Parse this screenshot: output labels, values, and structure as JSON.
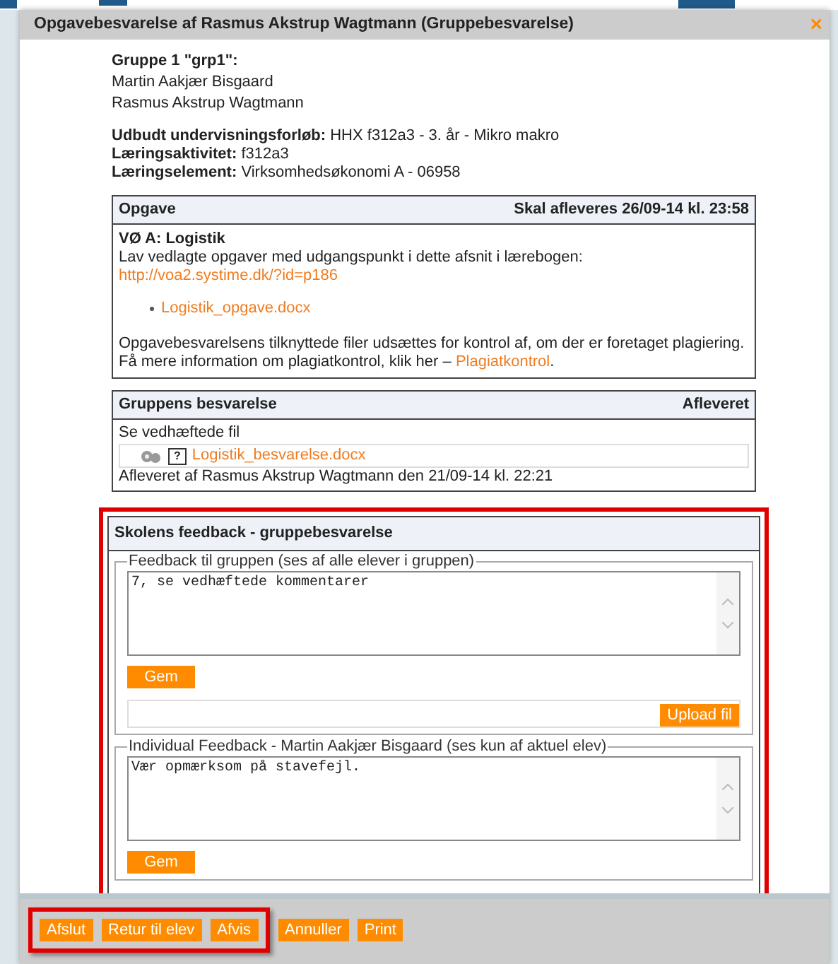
{
  "window": {
    "title": "Opgavebesvarelse af Rasmus Akstrup Wagtmann (Gruppebesvarelse)",
    "close": "×"
  },
  "group": {
    "heading": "Gruppe 1 \"grp1\":",
    "members": [
      "Martin Aakjær Bisgaard",
      "Rasmus Akstrup Wagtmann"
    ]
  },
  "info": [
    {
      "label": "Udbudt undervisningsforløb:",
      "value": "HHX f312a3 - 3. år - Mikro makro"
    },
    {
      "label": "Læringsaktivitet:",
      "value": "f312a3"
    },
    {
      "label": "Læringselement:",
      "value": "Virksomhedsøkonomi A - 06958"
    }
  ],
  "task": {
    "header_left": "Opgave",
    "header_right": "Skal afleveres 26/09-14 kl. 23:58",
    "title": "VØ A: Logistik",
    "text": "Lav vedlagte opgaver med udgangspunkt i dette afsnit i lærebogen:",
    "link_parts": [
      "http://voa2.systime.dk/?",
      "id=p186"
    ],
    "attachments": [
      "Logistik_opgave.docx"
    ],
    "plagiarism_text": "Opgavebesvarelsens tilknyttede filer udsættes for kontrol af, om der er foretaget plagiering. Få mere information om plagiatkontrol, klik her –",
    "plagiarism_link": "Plagiatkontrol",
    "plagiarism_end": "."
  },
  "submission": {
    "header_left": "Gruppens besvarelse",
    "header_right": "Afleveret",
    "text": "Se vedhæftede fil",
    "file_help": "?",
    "file": "Logistik_besvarelse.docx",
    "delivered": "Afleveret af Rasmus Akstrup Wagtmann den 21/09-14 kl. 22:21"
  },
  "feedback": {
    "heading": "Skolens feedback - gruppebesvarelse",
    "highlighted": true,
    "group": {
      "legend": "Feedback til gruppen (ses af alle elever i gruppen)",
      "value": "7, se vedhæftede kommentarer",
      "save": "Gem",
      "upload": "Upload fil"
    },
    "individual": {
      "legend": "Individual Feedback - Martin Aakjær Bisgaard (ses kun af aktuel elev)",
      "value": "Vær opmærksom på stavefejl.",
      "save": "Gem"
    }
  },
  "footer": {
    "buttons": [
      {
        "label": "Afslut",
        "highlighted": true
      },
      {
        "label": "Retur til elev",
        "highlighted": true
      },
      {
        "label": "Afvis",
        "highlighted": true
      },
      {
        "label": "Annuller",
        "highlighted": false
      },
      {
        "label": "Print",
        "highlighted": false
      }
    ]
  }
}
